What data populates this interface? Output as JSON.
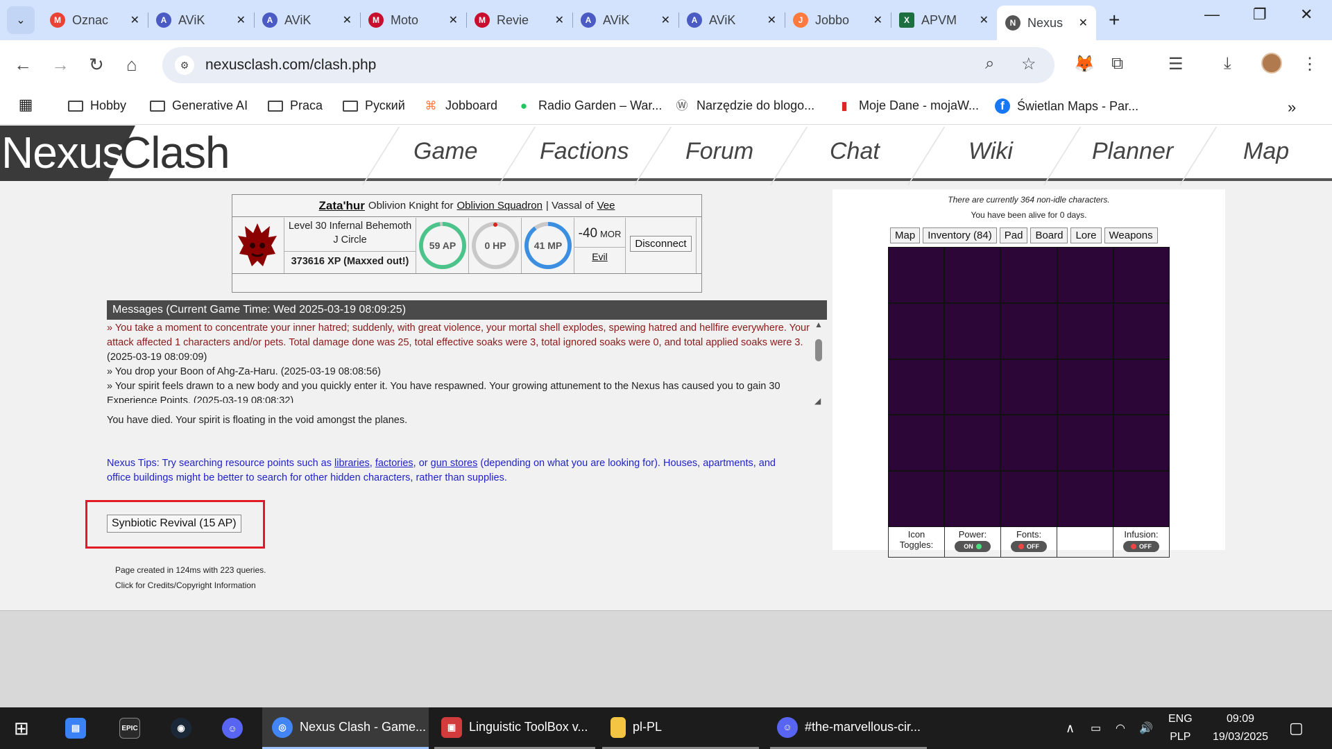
{
  "browser": {
    "tabs": [
      {
        "title": "Oznac",
        "color": "#ea4335",
        "glyph": "M"
      },
      {
        "title": "AViK",
        "color": "#4a5bc4",
        "glyph": "A"
      },
      {
        "title": "AViK",
        "color": "#4a5bc4",
        "glyph": "A"
      },
      {
        "title": "Moto",
        "color": "#c8102e",
        "glyph": "M"
      },
      {
        "title": "Revie",
        "color": "#c8102e",
        "glyph": "M"
      },
      {
        "title": "AViK",
        "color": "#4a5bc4",
        "glyph": "A"
      },
      {
        "title": "AViK",
        "color": "#4a5bc4",
        "glyph": "A"
      },
      {
        "title": "Jobbo",
        "color": "#ff7a3d",
        "glyph": "J"
      },
      {
        "title": "APVM",
        "color": "#1d6f42",
        "glyph": "X"
      },
      {
        "title": "Nexus",
        "color": "#555555",
        "glyph": "N"
      }
    ],
    "url": "nexusclash.com/clash.php",
    "bookmarks": [
      {
        "label": "Hobby",
        "type": "folder"
      },
      {
        "label": "Generative AI",
        "type": "folder"
      },
      {
        "label": "Praca",
        "type": "folder"
      },
      {
        "label": "Руский",
        "type": "folder"
      },
      {
        "label": "Jobboard",
        "type": "site",
        "glyph": "⌘",
        "color": "#ff7a3d"
      },
      {
        "label": "Radio Garden – War...",
        "type": "site",
        "glyph": "●",
        "color": "#22c55e"
      },
      {
        "label": "Narzędzie do blogo...",
        "type": "site",
        "glyph": "W",
        "color": "#555555"
      },
      {
        "label": "Moje Dane - mojaW...",
        "type": "site",
        "glyph": "▮",
        "color": "#dc2626"
      },
      {
        "label": "Świetlan Maps - Par...",
        "type": "site",
        "glyph": "f",
        "color": "#1877f2"
      }
    ]
  },
  "site": {
    "logo_a": "Nexus",
    "logo_b": "Clash",
    "nav": [
      "Game",
      "Factions",
      "Forum",
      "Chat",
      "Wiki",
      "Planner",
      "Map"
    ]
  },
  "character": {
    "name": "Zata'hur",
    "class_text": "Oblivion Knight for",
    "faction": "Oblivion Squadron",
    "vassal_text": "| Vassal of",
    "liege": "Vee",
    "level_line1": "Level 30 Infernal Behemoth",
    "level_line2": "J Circle",
    "xp": "373616 XP (Maxxed out!)",
    "ap": "59 AP",
    "hp": "0 HP",
    "mp": "41 MP",
    "ap_fraction": 0.98,
    "hp_fraction": 0.0,
    "mp_fraction": 0.9,
    "morality_value": "-40",
    "morality_unit": "MOR",
    "alignment": "Evil",
    "disconnect_label": "Disconnect"
  },
  "messages": {
    "header": "Messages (Current Game Time: Wed 2025-03-19 08:09:25)",
    "items": [
      {
        "style": "red",
        "text": "»  You take a moment to concentrate your inner hatred; suddenly, with great violence, your mortal shell explodes, spewing hatred and hellfire everywhere. Your attack affected 1 characters and/or pets. Total damage done was 25, total effective soaks were 3, total ignored soaks were 0, and total applied soaks were 3.",
        "time": " (2025-03-19 08:09:09)"
      },
      {
        "style": "black",
        "text": "»  You drop your Boon of Ahg-Za-Haru.",
        "time": " (2025-03-19 08:08:56)"
      },
      {
        "style": "black",
        "text": "»  Your spirit feels drawn to a new body and you quickly enter it. You have respawned. Your growing attunement to the Nexus has caused you to gain 30 Experience Points.",
        "time": " (2025-03-19 08:08:32)"
      }
    ],
    "dead_message": "You have died. Your spirit is floating in the void amongst the planes."
  },
  "tips": {
    "prefix": "Nexus Tips: Try searching resource points such as",
    "link1": "libraries",
    "sep1": ",",
    "link2": "factories",
    "sep2": ", or",
    "link3": "gun stores",
    "suffix": "(depending on what you are looking for). Houses, apartments, and office buildings might be better to search for other hidden characters, rather than supplies."
  },
  "actions": {
    "revive_label": "Synbiotic Revival (15 AP)"
  },
  "footer": {
    "line1": "Page created in 124ms with 223 queries.",
    "line2": "Click for Credits/Copyright Information"
  },
  "right_panel": {
    "line1": "There are currently 364 non-idle characters.",
    "line2": "You have been alive for 0 days.",
    "tabs": [
      "Map",
      "Inventory (84)",
      "Pad",
      "Board",
      "Lore",
      "Weapons"
    ],
    "toggles": {
      "icon_label_1": "Icon",
      "icon_label_2": "Toggles:",
      "power_label": "Power:",
      "power_state": "ON",
      "fonts_label": "Fonts:",
      "fonts_state": "OFF",
      "infusion_label": "Infusion:",
      "infusion_state": "OFF"
    }
  },
  "taskbar": {
    "apps": [
      {
        "label": "Nexus Clash - Game...",
        "color": "#4285f4"
      },
      {
        "label": "Linguistic ToolBox v...",
        "color": "#d23b3b"
      },
      {
        "label": "pl-PL",
        "color": "#f4c542"
      },
      {
        "label": "#the-marvellous-cir...",
        "color": "#5865f2"
      }
    ],
    "lang1": "ENG",
    "lang2": "PLP",
    "time": "09:09",
    "date": "19/03/2025"
  }
}
